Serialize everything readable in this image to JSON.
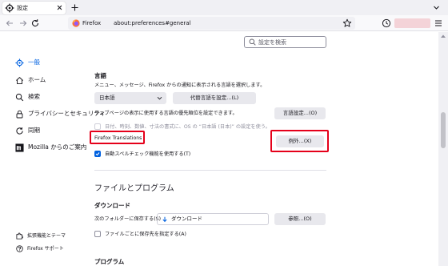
{
  "browser": {
    "tab_title": "設定",
    "identity_label": "Firefox",
    "url": "about:preferences#general"
  },
  "search": {
    "placeholder": "設定を検索"
  },
  "sidebar": {
    "items": [
      {
        "label": "一般",
        "icon": "gear-icon",
        "selected": true
      },
      {
        "label": "ホーム",
        "icon": "home-icon"
      },
      {
        "label": "検索",
        "icon": "search-icon"
      },
      {
        "label": "プライバシーとセキュリティ",
        "icon": "lock-icon"
      },
      {
        "label": "同期",
        "icon": "sync-icon"
      },
      {
        "label": "Mozilla からのご案内",
        "icon": "mozilla-icon"
      }
    ],
    "footer": [
      {
        "label": "拡張機能とテーマ",
        "icon": "puzzle-icon"
      },
      {
        "label": "Firefox サポート",
        "icon": "help-icon"
      }
    ]
  },
  "language": {
    "heading": "言語",
    "description": "メニュー、メッセージ、Firefox からの通知に表示される言語を選択します。",
    "selected_language": "日本語",
    "alternatives_button": "代替言語を設定...(L)",
    "webpage_desc": "ウェブページの表示に使用する言語の優先順位を設定できます。",
    "language_settings_button": "言語設定...(O)",
    "regional_format_checkbox": "日付、時刻、数値、寸法の書式に、OS の “日本語 (日本)” の設定を使う。",
    "translations_label": "Firefox Translations",
    "exceptions_button": "例外...(X)",
    "spellcheck_checkbox": "自動スペルチェック機能を使用する(T)"
  },
  "files": {
    "heading": "ファイルとプログラム",
    "downloads_heading": "ダウンロード",
    "save_to_label": "次のフォルダーに保存する(S)",
    "folder_name": "ダウンロード",
    "browse_button": "参照...(O)",
    "ask_checkbox": "ファイルごとに保存先を指定する(A)"
  },
  "programs": {
    "heading": "プログラム"
  },
  "colors": {
    "accent": "#0061e0",
    "highlight": "#e5001a"
  }
}
